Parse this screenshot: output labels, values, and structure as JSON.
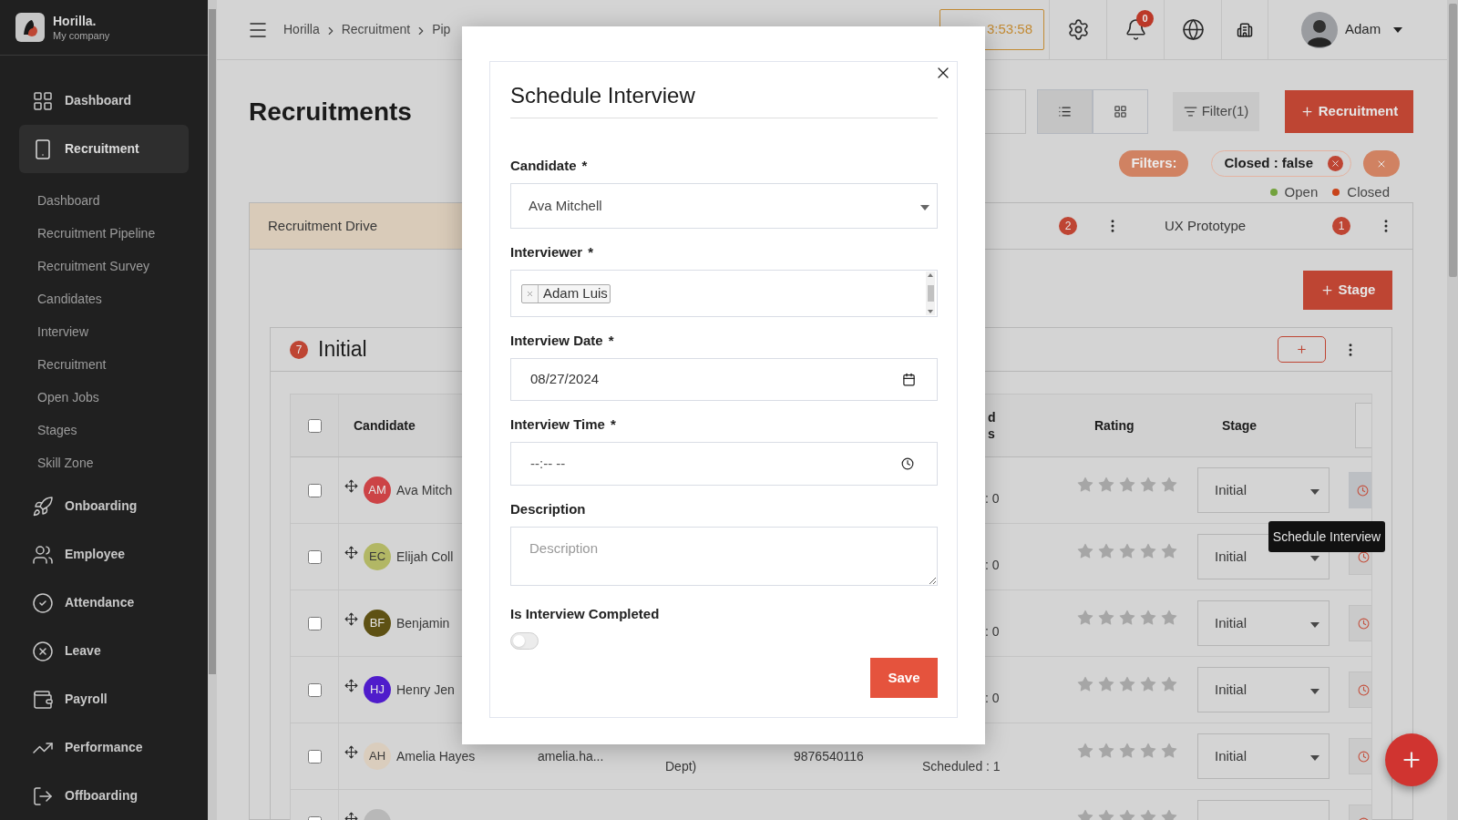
{
  "sidebar": {
    "brand": {
      "name": "Horilla.",
      "company": "My company"
    },
    "items": [
      {
        "label": "Dashboard",
        "selected": false
      },
      {
        "label": "Recruitment",
        "selected": true,
        "children": [
          {
            "label": "Dashboard"
          },
          {
            "label": "Recruitment Pipeline"
          },
          {
            "label": "Recruitment Survey"
          },
          {
            "label": "Candidates"
          },
          {
            "label": "Interview"
          },
          {
            "label": "Recruitment"
          },
          {
            "label": "Open Jobs"
          },
          {
            "label": "Stages"
          },
          {
            "label": "Skill Zone"
          }
        ]
      },
      {
        "label": "Onboarding",
        "selected": false
      },
      {
        "label": "Employee",
        "selected": false
      },
      {
        "label": "Attendance",
        "selected": false
      },
      {
        "label": "Leave",
        "selected": false
      },
      {
        "label": "Payroll",
        "selected": false
      },
      {
        "label": "Performance",
        "selected": false
      },
      {
        "label": "Offboarding",
        "selected": false
      }
    ]
  },
  "topbar": {
    "breadcrumbs": [
      "Horilla",
      "Recruitment",
      "Pip"
    ],
    "clock": "3:53:58",
    "notifications": "0",
    "user": "Adam"
  },
  "page": {
    "title": "Recruitments",
    "views": [
      {
        "kind": "list",
        "selected": true
      },
      {
        "kind": "grid",
        "selected": false
      }
    ],
    "filter_button": "Filter(1)",
    "add_button": "Recruitment",
    "filters_label": "Filters:",
    "filter_chips": [
      {
        "label": "Closed : false"
      }
    ],
    "legend": [
      {
        "label": "Open",
        "color": "#73a23d"
      },
      {
        "label": "Closed",
        "color": "#c8431a"
      }
    ],
    "tabs": [
      {
        "label": "Recruitment Drive",
        "selected": true
      },
      {
        "count": "2",
        "selected": false
      },
      {
        "label": "UX Prototype",
        "count": "1",
        "selected": false
      }
    ],
    "stage_button": "Stage",
    "stage": {
      "count": "7",
      "title": "Initial"
    },
    "table": {
      "select_all": {
        "checked": false
      },
      "header": {
        "candidate": "Candidate",
        "column_6": [
          "d",
          "s"
        ],
        "rating": "Rating",
        "stage": "Stage"
      },
      "rows": [
        {
          "checked": false,
          "initials": "AM",
          "color": "#cc4346",
          "name": "Ava Mitch",
          "interviews_tail": ": 0",
          "stars": 0,
          "stage": "Initial",
          "highlighted": true
        },
        {
          "checked": false,
          "initials": "EC",
          "color": "#b2b765",
          "name": "Elijah Coll",
          "interviews_tail": ": 0",
          "stars": 0,
          "stage": "Initial",
          "highlighted": false
        },
        {
          "checked": false,
          "initials": "BF",
          "color": "#5e5114",
          "name": "Benjamin",
          "interviews_tail": ": 0",
          "stars": 0,
          "stage": "Initial",
          "highlighted": false
        },
        {
          "checked": false,
          "initials": "HJ",
          "color": "#4f1ccb",
          "name": "Henry Jen",
          "interviews_tail": ": 0",
          "stars": 0,
          "stage": "Initial",
          "highlighted": false
        },
        {
          "checked": false,
          "initials": "AH",
          "color": "#dacdbd",
          "name": "Amelia Hayes",
          "email": "amelia.ha...",
          "job": "Dept)",
          "phone": "9876540116",
          "interviews": "Scheduled : 1",
          "stars": 0,
          "stage": "Initial",
          "highlighted": false
        },
        {
          "checked": false,
          "color": "#b8b8b8",
          "stars": 0,
          "highlighted": false
        }
      ]
    }
  },
  "tooltip": "Schedule Interview",
  "modal": {
    "title": "Schedule Interview",
    "fields": [
      {
        "kind": "select",
        "label": "Candidate",
        "mark": "*",
        "value": "Ava Mitchell"
      },
      {
        "kind": "multiselect",
        "label": "Interviewer",
        "mark": "*",
        "chips": [
          "Adam Luis"
        ]
      },
      {
        "kind": "date",
        "label": "Interview Date",
        "mark": "*",
        "value": "08/27/2024"
      },
      {
        "kind": "time",
        "label": "Interview Time",
        "mark": "*",
        "placeholder": "--:-- --"
      },
      {
        "kind": "textarea",
        "label": "Description",
        "placeholder": "Description"
      },
      {
        "kind": "toggle",
        "label": "Is Interview Completed",
        "on": false
      }
    ],
    "save": "Save"
  }
}
